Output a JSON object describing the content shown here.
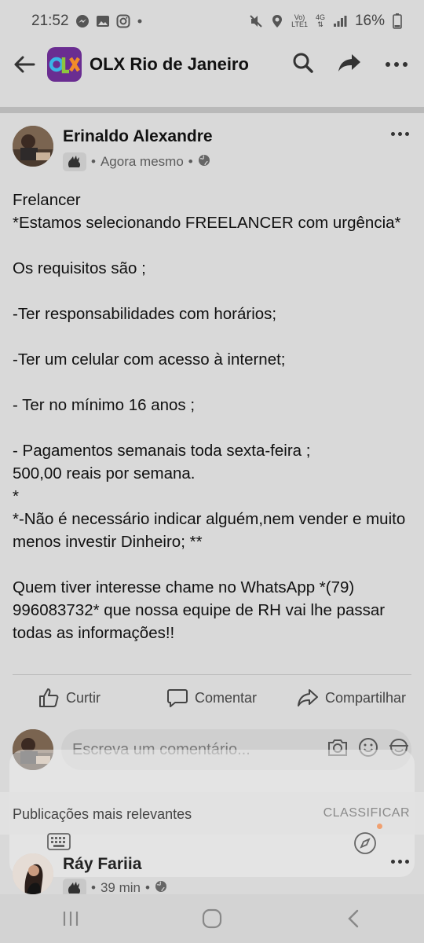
{
  "status_bar": {
    "time": "21:52",
    "battery": "16%",
    "network_top": "Vo)",
    "network_bottom": "LTE1",
    "network_type": "4G",
    "left_icons": [
      "messenger-icon",
      "gallery-icon",
      "instagram-icon",
      "dot-icon"
    ],
    "right_icons": [
      "mute-icon",
      "location-icon",
      "signal-icon",
      "battery-icon"
    ]
  },
  "app_bar": {
    "title": "OLX Rio de Janeiro",
    "logo_text": "OLX",
    "icons": [
      "back-arrow-icon",
      "search-icon",
      "share-icon",
      "more-icon"
    ]
  },
  "post": {
    "author": "Erinaldo Alexandre",
    "time": "Agora mesmo",
    "separator": "•",
    "body": [
      "Frelancer",
      "*Estamos selecionando FREELANCER com urgência*",
      "",
      "Os requisitos são ;",
      "",
      "-Ter responsabilidades com horários;",
      "",
      "-Ter um celular com acesso à internet;",
      "",
      "- Ter no mínimo 16 anos ;",
      "",
      "- Pagamentos semanais toda sexta-feira ;",
      "500,00 reais por semana.",
      "*",
      "*-Não é necessário indicar alguém,nem vender e muito menos investir Dinheiro; **",
      "",
      "Quem tiver interesse chame no WhatsApp *(79) 996083732* que nossa equipe de RH vai lhe passar todas as informações!!"
    ]
  },
  "actions": {
    "like": "Curtir",
    "comment": "Comentar",
    "share": "Compartilhar"
  },
  "comment_input": {
    "placeholder": "Escreva um comentário..."
  },
  "comments_section": {
    "label": "Publicações mais relevantes",
    "sort": "CLASSIFICAR"
  },
  "comment": {
    "author": "Ráy Fariia",
    "time": "39 min",
    "separator": "•"
  },
  "colors": {
    "background": "#d9d9d9",
    "logo_bg": "#6a2d91",
    "logo_orange": "#f28c28",
    "logo_green": "#8dc63f",
    "logo_blue": "#3ab5e6"
  }
}
